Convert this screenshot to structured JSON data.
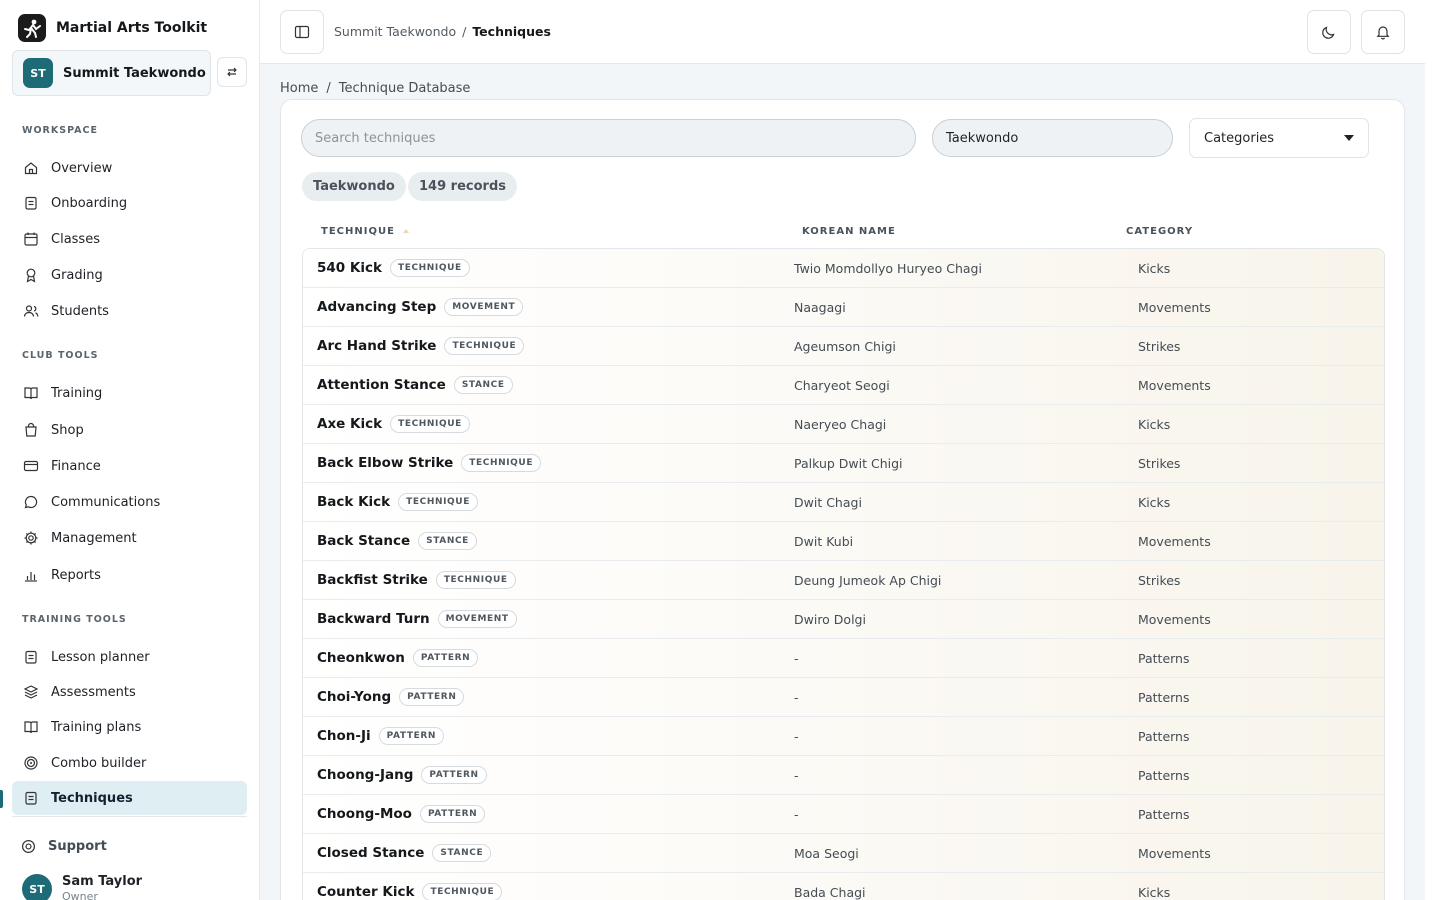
{
  "app": {
    "name": "Martial Arts Toolkit"
  },
  "club": {
    "initials": "ST",
    "name": "Summit Taekwondo"
  },
  "sidebar": {
    "workspace_label": "WORKSPACE",
    "workspace": [
      "Overview",
      "Onboarding",
      "Classes",
      "Grading",
      "Students"
    ],
    "club_tools_label": "CLUB TOOLS",
    "club_tools": [
      "Training",
      "Shop",
      "Finance",
      "Communications",
      "Management",
      "Reports"
    ],
    "training_tools_label": "TRAINING TOOLS",
    "training_tools": [
      "Lesson planner",
      "Assessments",
      "Training plans",
      "Combo builder",
      "Techniques"
    ],
    "support": "Support",
    "user": {
      "initials": "ST",
      "name": "Sam Taylor",
      "role": "Owner"
    }
  },
  "topbar": {
    "crumb_club": "Summit Taekwondo",
    "crumb_sep": "/",
    "crumb_page": "Techniques"
  },
  "breadcrumb": {
    "home": "Home",
    "sep": "/",
    "current": "Technique Database"
  },
  "filters": {
    "search_placeholder": "Search techniques",
    "style_value": "Taekwondo",
    "category_label": "Categories"
  },
  "chips": {
    "style": "Taekwondo",
    "records": "149 records"
  },
  "table": {
    "headers": {
      "technique": "TECHNIQUE",
      "korean": "KOREAN NAME",
      "category": "CATEGORY"
    },
    "rows": [
      {
        "name": "540 Kick",
        "tag": "TECHNIQUE",
        "korean": "Twio Momdollyo Huryeo Chagi",
        "category": "Kicks"
      },
      {
        "name": "Advancing Step",
        "tag": "MOVEMENT",
        "korean": "Naagagi",
        "category": "Movements"
      },
      {
        "name": "Arc Hand Strike",
        "tag": "TECHNIQUE",
        "korean": "Ageumson Chigi",
        "category": "Strikes"
      },
      {
        "name": "Attention Stance",
        "tag": "STANCE",
        "korean": "Charyeot Seogi",
        "category": "Movements"
      },
      {
        "name": "Axe Kick",
        "tag": "TECHNIQUE",
        "korean": "Naeryeo Chagi",
        "category": "Kicks"
      },
      {
        "name": "Back Elbow Strike",
        "tag": "TECHNIQUE",
        "korean": "Palkup Dwit Chigi",
        "category": "Strikes"
      },
      {
        "name": "Back Kick",
        "tag": "TECHNIQUE",
        "korean": "Dwit Chagi",
        "category": "Kicks"
      },
      {
        "name": "Back Stance",
        "tag": "STANCE",
        "korean": "Dwit Kubi",
        "category": "Movements"
      },
      {
        "name": "Backfist Strike",
        "tag": "TECHNIQUE",
        "korean": "Deung Jumeok Ap Chigi",
        "category": "Strikes"
      },
      {
        "name": "Backward Turn",
        "tag": "MOVEMENT",
        "korean": "Dwiro Dolgi",
        "category": "Movements"
      },
      {
        "name": "Cheonkwon",
        "tag": "PATTERN",
        "korean": "-",
        "category": "Patterns"
      },
      {
        "name": "Choi-Yong",
        "tag": "PATTERN",
        "korean": "-",
        "category": "Patterns"
      },
      {
        "name": "Chon-Ji",
        "tag": "PATTERN",
        "korean": "-",
        "category": "Patterns"
      },
      {
        "name": "Choong-Jang",
        "tag": "PATTERN",
        "korean": "-",
        "category": "Patterns"
      },
      {
        "name": "Choong-Moo",
        "tag": "PATTERN",
        "korean": "-",
        "category": "Patterns"
      },
      {
        "name": "Closed Stance",
        "tag": "STANCE",
        "korean": "Moa Seogi",
        "category": "Movements"
      },
      {
        "name": "Counter Kick",
        "tag": "TECHNIQUE",
        "korean": "Bada Chagi",
        "category": "Kicks"
      }
    ]
  },
  "icons": {
    "workspace": [
      "home-icon",
      "clipboard-icon",
      "calendar-icon",
      "award-icon",
      "users-icon"
    ],
    "club_tools": [
      "book-icon",
      "shopping-bag-icon",
      "credit-card-icon",
      "message-icon",
      "gear-icon",
      "bar-chart-icon"
    ],
    "training_tools": [
      "clipboard-icon",
      "layers-icon",
      "book-icon",
      "target-icon",
      "clipboard-icon"
    ]
  },
  "colors": {
    "accent": "#1e6b78",
    "active_bg": "#dfeef3"
  }
}
